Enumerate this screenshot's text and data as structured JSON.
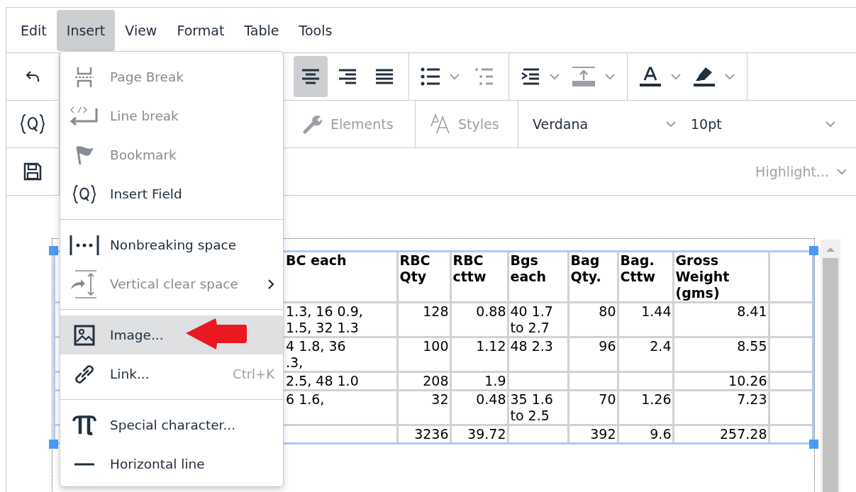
{
  "menubar": [
    {
      "label": "Edit",
      "selected": false
    },
    {
      "label": "Insert",
      "selected": true
    },
    {
      "label": "View",
      "selected": false
    },
    {
      "label": "Format",
      "selected": false
    },
    {
      "label": "Table",
      "selected": false
    },
    {
      "label": "Tools",
      "selected": false
    }
  ],
  "toolbar_row_1": {
    "groups": [
      [
        {
          "kind": "undo",
          "selected": false,
          "disabled": false,
          "split": false
        }
      ],
      [
        {
          "kind": "align-center",
          "selected": true,
          "disabled": false,
          "split": false
        },
        {
          "kind": "align-right",
          "selected": false,
          "disabled": false,
          "split": false
        },
        {
          "kind": "align-justify",
          "selected": false,
          "disabled": false,
          "split": false
        }
      ],
      [
        {
          "kind": "bullet-list",
          "selected": false,
          "disabled": false,
          "split": true
        },
        {
          "kind": "numbered-list",
          "selected": false,
          "disabled": true,
          "split": false
        }
      ],
      [
        {
          "kind": "indent",
          "selected": false,
          "disabled": false,
          "split": true
        },
        {
          "kind": "vertical-align",
          "selected": false,
          "disabled": true,
          "split": true
        }
      ],
      [
        {
          "kind": "text-color",
          "selected": false,
          "disabled": false,
          "split": true
        },
        {
          "kind": "highlighter",
          "selected": false,
          "disabled": false,
          "split": true
        }
      ]
    ]
  },
  "toolbar_row_2": {
    "quick_button": {
      "kind": "field"
    },
    "elements": {
      "label": "Elements",
      "disabled": true
    },
    "styles": {
      "label": "Styles",
      "disabled": true
    },
    "font": {
      "value": "Verdana"
    },
    "size": {
      "value": "10pt"
    }
  },
  "toolbar_row_3": {
    "quick_button": {
      "kind": "save"
    },
    "highlight": {
      "label": "Highlight...",
      "disabled": true
    }
  },
  "insert_menu": {
    "groups": [
      [
        {
          "kind": "page-break",
          "label": "Page Break",
          "disabled": true,
          "selected": false
        },
        {
          "kind": "line-break",
          "label": "Line break",
          "disabled": true,
          "selected": false
        },
        {
          "kind": "bookmark",
          "label": "Bookmark",
          "disabled": true,
          "selected": false
        },
        {
          "kind": "field",
          "label": "Insert Field",
          "disabled": false,
          "selected": false
        }
      ],
      [
        {
          "kind": "nbsp",
          "label": "Nonbreaking space",
          "disabled": false,
          "selected": false
        },
        {
          "kind": "vspace",
          "label": "Vertical clear space",
          "disabled": true,
          "selected": false,
          "submenu": true
        }
      ],
      [
        {
          "kind": "image",
          "label": "Image...",
          "disabled": false,
          "selected": true
        },
        {
          "kind": "link",
          "label": "Link...",
          "shortcut": "Ctrl+K",
          "disabled": false,
          "selected": false
        }
      ],
      [
        {
          "kind": "special-char",
          "label": "Special character...",
          "disabled": false,
          "selected": false
        },
        {
          "kind": "hline",
          "label": "Horizontal line",
          "disabled": false,
          "selected": false
        }
      ]
    ]
  },
  "table": {
    "columns": [
      "BC each",
      "RBC\nQty",
      "RBC\ncttw",
      "Bgs\neach",
      "Bag\nQty.",
      "Bag.\nCttw",
      "Gross\nWeight\n(gms)"
    ],
    "rows": [
      [
        "1.3, 16 0.9,\n1.5, 32 1.3",
        "128",
        "0.88",
        "40 1.7\nto 2.7",
        "80",
        "1.44",
        "8.41"
      ],
      [
        "4 1.8, 36\n.3,",
        "100",
        "1.12",
        "48 2.3",
        "96",
        "2.4",
        "8.55"
      ],
      [
        "2.5, 48 1.0",
        "208",
        "1.9",
        null,
        null,
        null,
        "10.26"
      ],
      [
        "6 1.6,",
        "32",
        "0.48",
        "35 1.6\nto 2.5",
        "70",
        "1.26",
        "7.23"
      ],
      [
        null,
        "3236",
        "39.72",
        null,
        "392",
        "9.6",
        "257.28"
      ]
    ]
  }
}
